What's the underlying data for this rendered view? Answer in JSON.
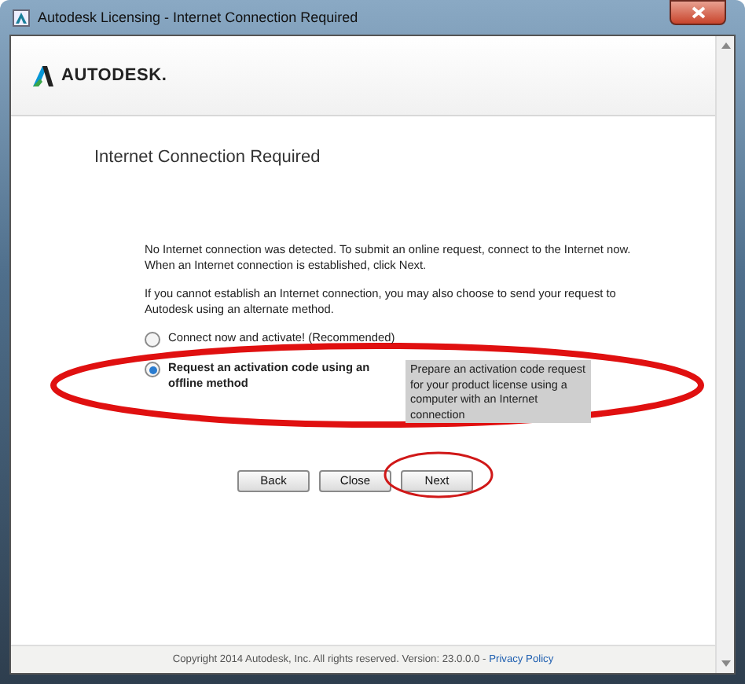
{
  "window": {
    "title": "Autodesk Licensing - Internet Connection Required"
  },
  "header": {
    "logo_text": "AUTODESK."
  },
  "page_title": "Internet Connection Required",
  "messages": [
    "No Internet connection was detected. To submit an online request, connect to the Internet now. When an Internet connection is established, click Next.",
    "If you cannot establish an Internet connection, you may also choose to send your request to Autodesk using an alternate method."
  ],
  "options": [
    {
      "label": "Connect now and activate! (Recommended)",
      "selected": false
    },
    {
      "label": "Request an activation code using an offline method",
      "selected": true,
      "description": "Prepare an activation code request for your product license using a computer with an Internet connection"
    }
  ],
  "buttons": [
    {
      "label": "Back",
      "highlighted": false
    },
    {
      "label": "Close",
      "highlighted": false
    },
    {
      "label": "Next",
      "highlighted": true
    }
  ],
  "footer": {
    "copyright": "Copyright 2014 Autodesk, Inc. All rights reserved. Version: 23.0.0.0 -",
    "link": "Privacy Policy"
  }
}
